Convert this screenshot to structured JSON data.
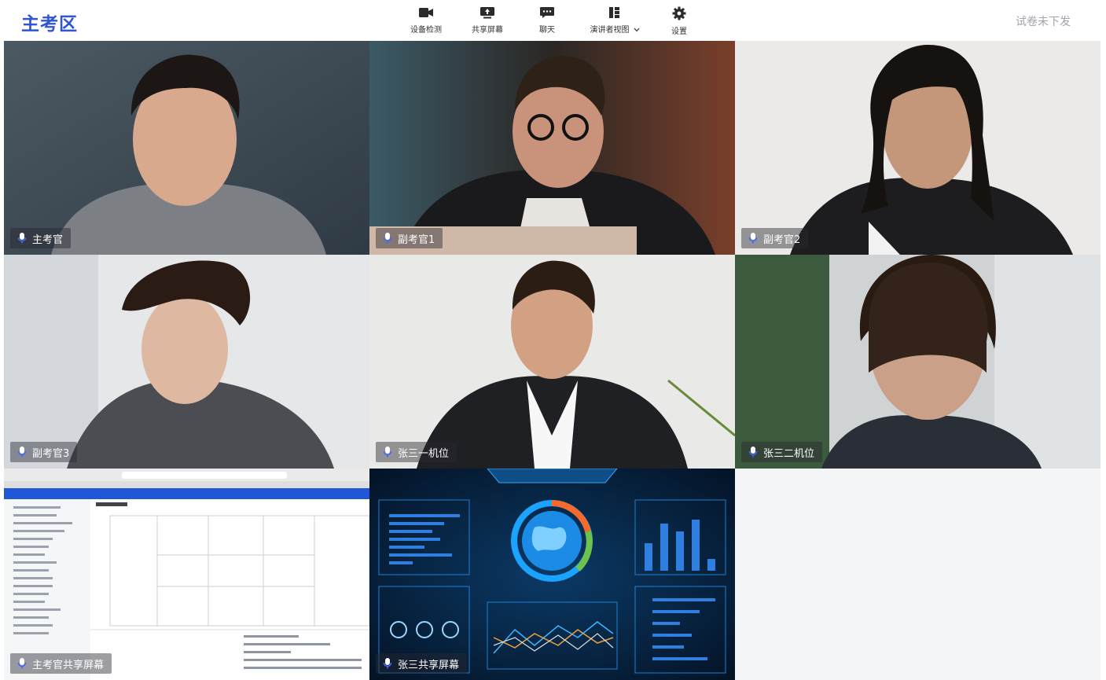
{
  "header": {
    "title": "主考区",
    "status_text": "试卷未下发"
  },
  "toolbar": {
    "items": [
      {
        "label": "设备检测",
        "icon": "camera-icon"
      },
      {
        "label": "共享屏幕",
        "icon": "share-screen-icon"
      },
      {
        "label": "聊天",
        "icon": "chat-icon"
      },
      {
        "label": "演讲者视图",
        "icon": "speaker-view-icon",
        "dropdown": true
      },
      {
        "label": "设置",
        "icon": "gear-icon"
      }
    ]
  },
  "participants": [
    {
      "name": "主考官"
    },
    {
      "name": "副考官1"
    },
    {
      "name": "副考官2"
    },
    {
      "name": "副考官3"
    },
    {
      "name": "张三一机位"
    },
    {
      "name": "张三二机位"
    },
    {
      "name": "主考官共享屏幕"
    },
    {
      "name": "张三共享屏幕"
    }
  ],
  "colors": {
    "brand": "#2f54d6",
    "mic": "#3d6bff",
    "status": "#a0a4ab"
  }
}
